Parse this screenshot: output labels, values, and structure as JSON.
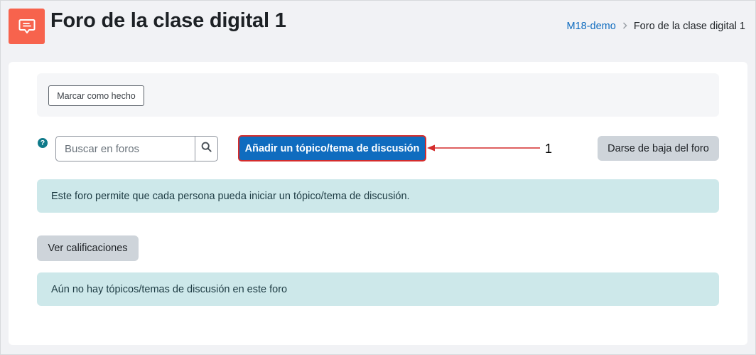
{
  "header": {
    "title": "Foro de la clase digital 1",
    "icon": "forum-icon",
    "icon_color": "#f7634d"
  },
  "breadcrumb": {
    "items": [
      {
        "label": "M18-demo",
        "link": true
      },
      {
        "label": "Foro de la clase digital 1",
        "link": false
      }
    ]
  },
  "completion": {
    "mark_done_label": "Marcar como hecho"
  },
  "search": {
    "placeholder": "Buscar en foros",
    "value": "",
    "icon": "search-icon"
  },
  "help_icon": "question-circle-icon",
  "actions": {
    "add_topic_label": "Añadir un tópico/tema de discusión",
    "unsubscribe_label": "Darse de baja del foro",
    "grades_label": "Ver calificaciones"
  },
  "annotation": {
    "number": "1",
    "color": "#d42c2c"
  },
  "alerts": {
    "forum_info": "Este foro permite que cada persona pueda iniciar un tópico/tema de discusión.",
    "no_topics": "Aún no hay tópicos/temas de discusión en este foro"
  },
  "colors": {
    "primary": "#0f6cbf",
    "secondary": "#ced4da",
    "info_bg": "#cde8ea"
  }
}
